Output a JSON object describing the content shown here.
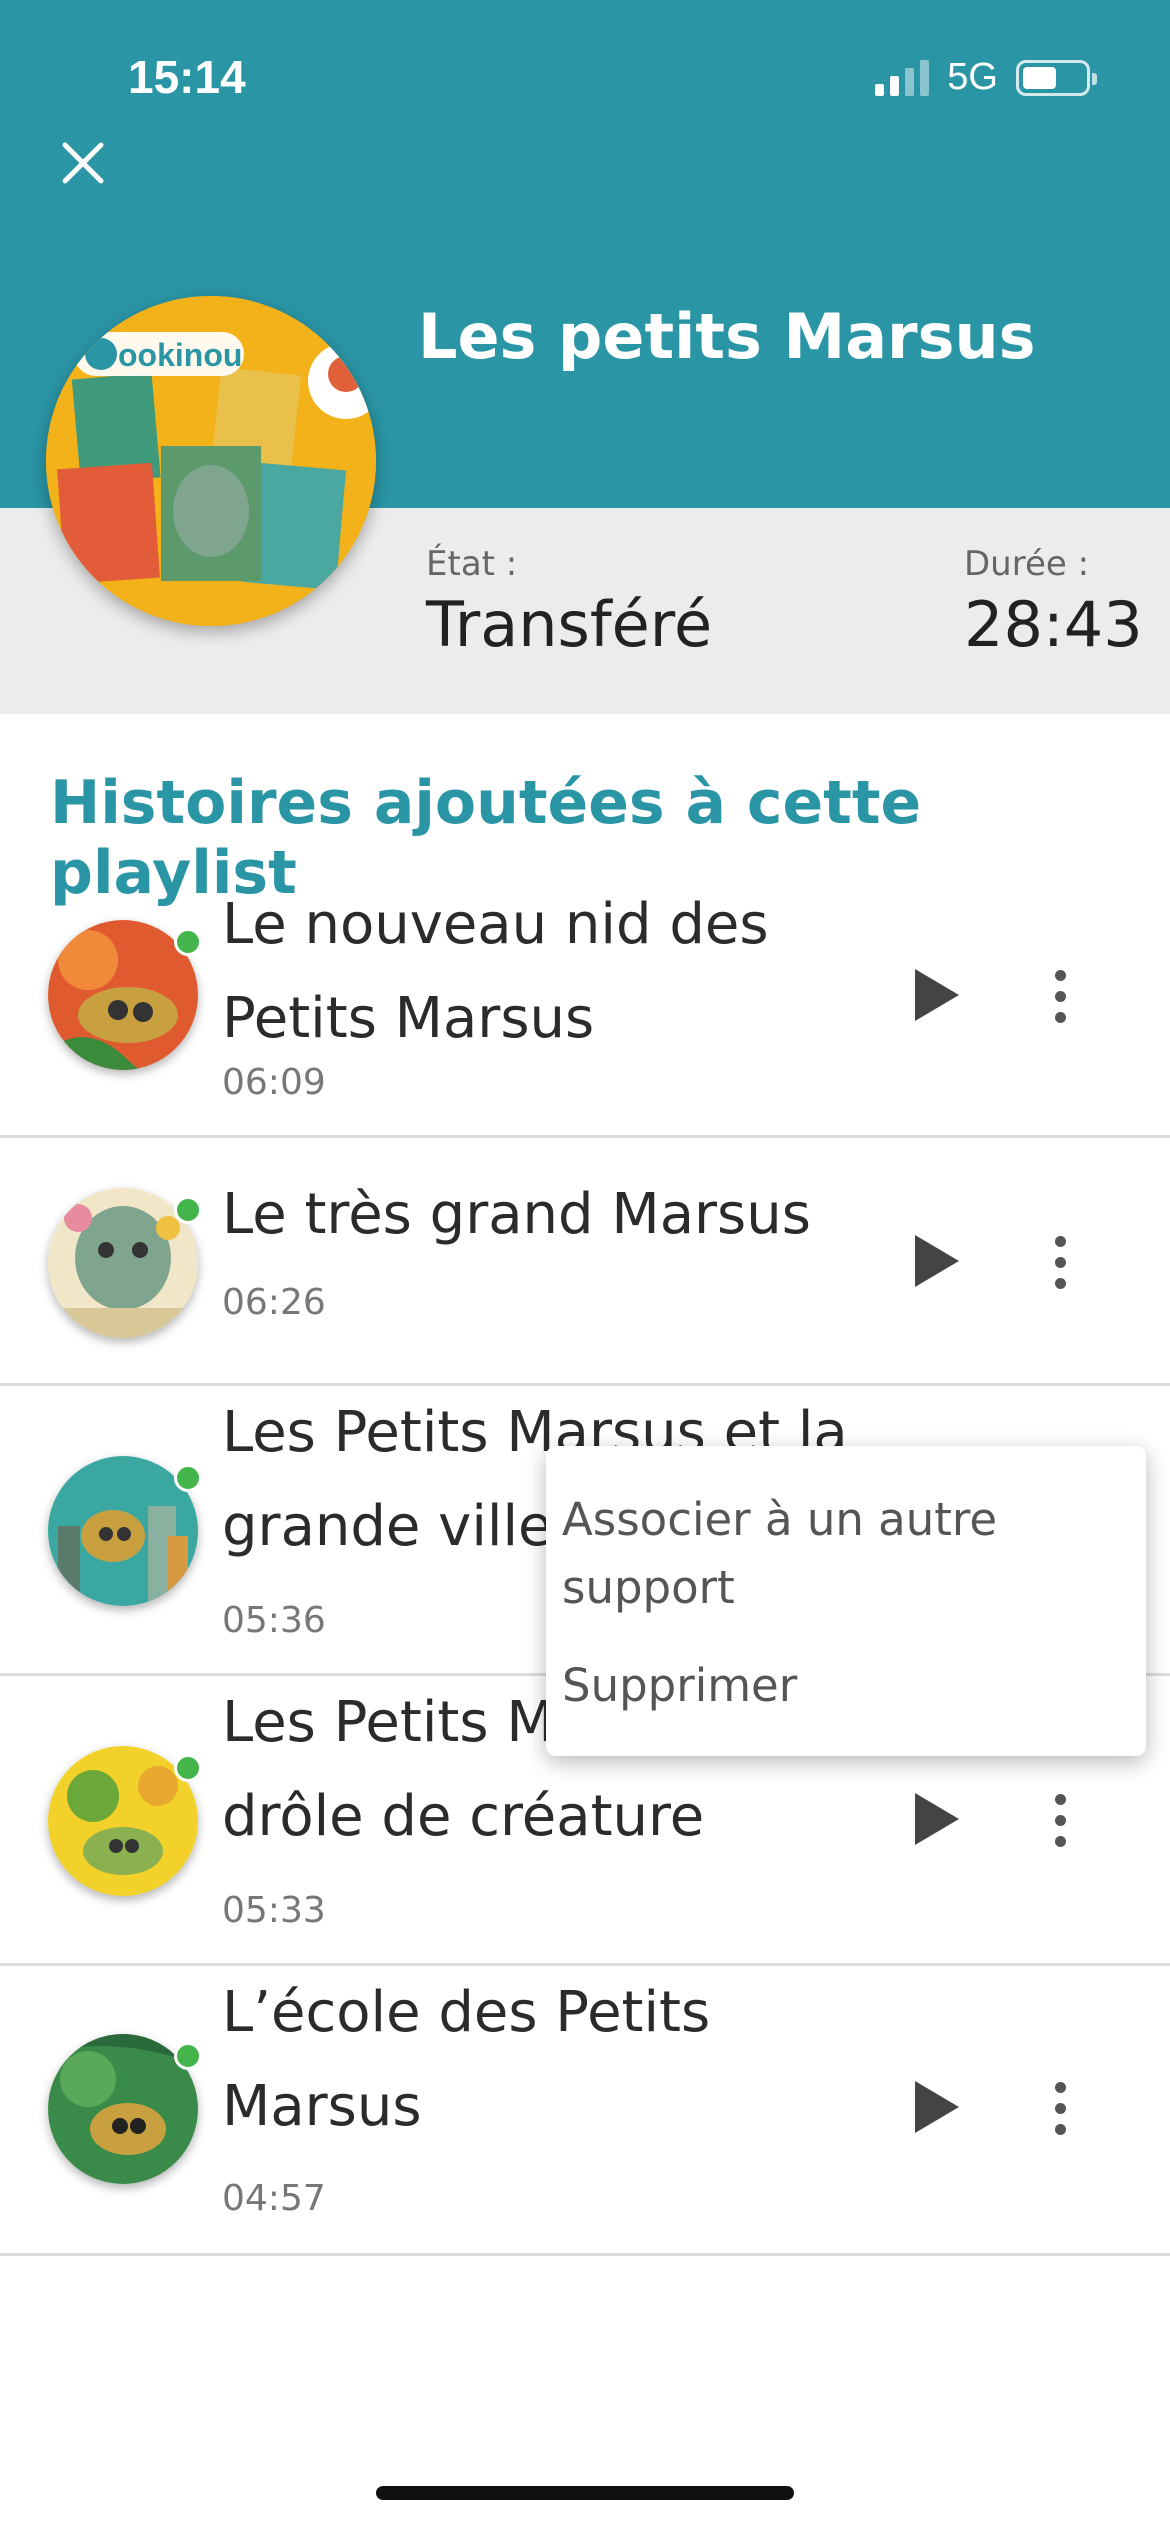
{
  "status_bar": {
    "time": "15:14",
    "network": "5G"
  },
  "header": {
    "close_icon": "close-icon",
    "playlist_title": "Les petits Marsus",
    "cover_logo": "ookinou"
  },
  "info": {
    "state_label": "État :",
    "state_value": "Transféré",
    "duration_label": "Durée :",
    "duration_value": "28:43"
  },
  "section_title": "Histoires ajoutées à cette playlist",
  "tracks": [
    {
      "title": "Le nouveau nid des Petits Marsus",
      "duration": "06:09",
      "status": "transferred"
    },
    {
      "title": "Le très grand Marsus",
      "duration": "06:26",
      "status": "transferred"
    },
    {
      "title": "Les Petits Marsus et la grande ville",
      "duration": "05:36",
      "status": "transferred"
    },
    {
      "title": "Les Petits Marsus et la drôle de créature",
      "duration": "05:33",
      "status": "transferred"
    },
    {
      "title": "L’école des Petits Marsus",
      "duration": "04:57",
      "status": "transferred"
    }
  ],
  "context_menu": {
    "item_associate": "Associer à un autre support",
    "item_delete": "Supprimer"
  },
  "colors": {
    "accent": "#2a95a5",
    "status_dot": "#43b54a",
    "info_band": "#ececec"
  }
}
